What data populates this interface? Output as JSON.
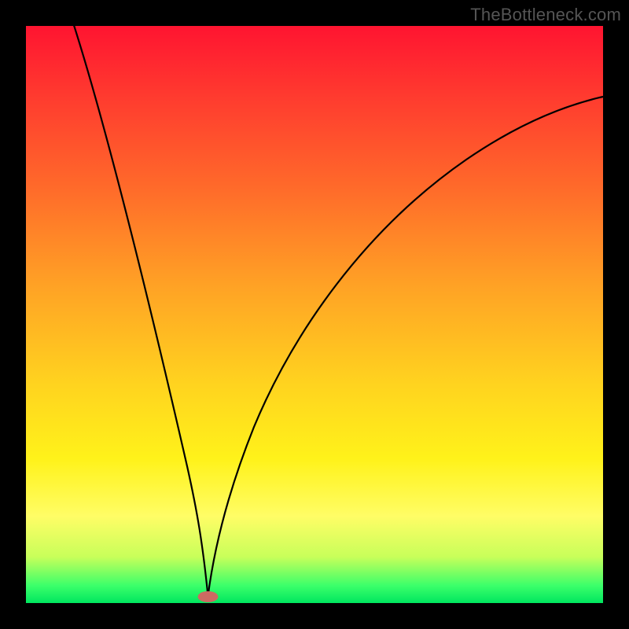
{
  "watermark": "TheBottleneck.com",
  "chart_data": {
    "type": "line",
    "title": "",
    "xlabel": "",
    "ylabel": "",
    "xlim": [
      0,
      100
    ],
    "ylim": [
      0,
      100
    ],
    "series": [
      {
        "name": "curve",
        "x": [
          0,
          4,
          8,
          12,
          16,
          20,
          24,
          27,
          30,
          31,
          32,
          34,
          37,
          41,
          46,
          52,
          60,
          70,
          82,
          100
        ],
        "values": [
          115,
          100,
          86,
          72,
          58,
          44,
          30,
          18,
          8,
          3,
          0,
          4,
          12,
          24,
          36,
          48,
          59,
          69,
          77,
          86
        ]
      }
    ],
    "minimum_marker": {
      "x": 31.5,
      "value": 0
    },
    "gradient_stops": [
      {
        "pos": 0,
        "color": "#ff1430"
      },
      {
        "pos": 28,
        "color": "#ff6a2a"
      },
      {
        "pos": 62,
        "color": "#ffd31f"
      },
      {
        "pos": 85,
        "color": "#fffd66"
      },
      {
        "pos": 100,
        "color": "#00e65f"
      }
    ]
  }
}
